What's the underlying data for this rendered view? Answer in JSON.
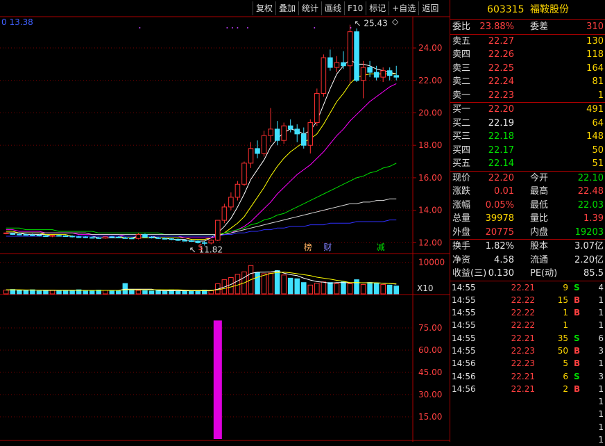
{
  "toolbar": [
    "复权",
    "叠加",
    "统计",
    "画线",
    "F10",
    "标记",
    "+自选",
    "返回"
  ],
  "stock": {
    "code": "603315",
    "name": "福鞍股份"
  },
  "main_chart": {
    "top_label": "0 13.38",
    "price_ticks": [
      "24.00",
      "22.00",
      "20.00",
      "18.00",
      "16.00",
      "14.00",
      "12.00"
    ],
    "high_label": "25.43",
    "low_label": "11.82",
    "events": [
      {
        "text": "$",
        "color": "#ff4040"
      },
      {
        "text": "榜",
        "color": "#ffb060"
      },
      {
        "text": "财",
        "color": "#8080ff"
      },
      {
        "text": "减",
        "color": "#00e000"
      }
    ],
    "marks": [
      "◇",
      "×"
    ]
  },
  "volume_chart": {
    "tick": "10000",
    "unit": "X10"
  },
  "indicator_chart": {
    "ticks": [
      "75.00",
      "60.00",
      "45.00",
      "30.00",
      "15.00"
    ],
    "bar_value": 80
  },
  "chart_data": {
    "type": "candlestick",
    "y_range": [
      11.5,
      25.8
    ],
    "candles": [
      [
        12.6,
        12.62,
        12.52,
        12.6
      ],
      [
        12.55,
        12.6,
        12.48,
        12.52
      ],
      [
        12.52,
        12.58,
        12.45,
        12.5
      ],
      [
        12.5,
        12.56,
        12.44,
        12.48
      ],
      [
        12.48,
        12.55,
        12.4,
        12.46
      ],
      [
        12.46,
        12.52,
        12.38,
        12.42
      ],
      [
        12.42,
        12.5,
        12.35,
        12.4
      ],
      [
        12.4,
        12.48,
        12.34,
        12.44
      ],
      [
        12.44,
        12.5,
        12.38,
        12.42
      ],
      [
        12.42,
        12.46,
        12.36,
        12.4
      ],
      [
        12.4,
        12.45,
        12.32,
        12.36
      ],
      [
        12.36,
        12.42,
        12.3,
        12.35
      ],
      [
        12.35,
        12.4,
        12.28,
        12.32
      ],
      [
        12.32,
        12.38,
        12.26,
        12.3
      ],
      [
        12.3,
        12.36,
        12.24,
        12.28
      ],
      [
        12.28,
        12.4,
        12.24,
        12.36
      ],
      [
        12.36,
        12.42,
        12.3,
        12.34
      ],
      [
        12.34,
        12.4,
        12.28,
        12.3
      ],
      [
        12.3,
        12.36,
        12.25,
        12.28
      ],
      [
        12.28,
        12.34,
        12.22,
        12.26
      ],
      [
        12.26,
        12.6,
        12.2,
        12.5
      ],
      [
        12.5,
        12.56,
        12.3,
        12.34
      ],
      [
        12.34,
        12.4,
        12.26,
        12.3
      ],
      [
        12.3,
        12.36,
        12.22,
        12.26
      ],
      [
        12.26,
        12.32,
        12.2,
        12.24
      ],
      [
        12.24,
        12.3,
        12.15,
        12.2
      ],
      [
        12.2,
        12.26,
        12.1,
        12.14
      ],
      [
        12.14,
        12.2,
        12.08,
        12.12
      ],
      [
        12.12,
        12.18,
        12.05,
        12.1
      ],
      [
        12.1,
        12.15,
        11.95,
        12.0
      ],
      [
        12.0,
        12.1,
        11.82,
        11.98
      ],
      [
        11.98,
        12.2,
        11.9,
        12.15
      ],
      [
        12.15,
        13.38,
        12.1,
        13.38
      ],
      [
        13.38,
        14.4,
        13.2,
        14.2
      ],
      [
        14.2,
        15.1,
        14.0,
        14.8
      ],
      [
        14.8,
        15.8,
        14.6,
        15.6
      ],
      [
        15.6,
        17.0,
        15.5,
        16.9
      ],
      [
        16.9,
        18.2,
        16.6,
        17.8
      ],
      [
        17.8,
        18.3,
        17.2,
        17.5
      ],
      [
        17.5,
        18.9,
        17.3,
        18.6
      ],
      [
        18.6,
        20.3,
        18.2,
        19.0
      ],
      [
        19.0,
        19.5,
        18.0,
        18.3
      ],
      [
        18.3,
        19.4,
        18.1,
        19.2
      ],
      [
        19.2,
        19.6,
        18.8,
        19.0
      ],
      [
        19.0,
        19.3,
        18.2,
        18.7
      ],
      [
        18.7,
        19.1,
        17.8,
        18.0
      ],
      [
        18.0,
        19.6,
        17.5,
        19.4
      ],
      [
        19.4,
        21.5,
        19.2,
        21.2
      ],
      [
        21.2,
        23.6,
        21.0,
        23.4
      ],
      [
        23.4,
        23.9,
        22.6,
        22.8
      ],
      [
        22.8,
        23.5,
        22.5,
        23.1
      ],
      [
        23.1,
        23.8,
        22.7,
        22.9
      ],
      [
        22.9,
        25.43,
        21.8,
        25.0
      ],
      [
        25.0,
        25.2,
        21.9,
        22.0
      ],
      [
        22.0,
        23.2,
        20.9,
        22.8
      ],
      [
        22.8,
        23.2,
        22.2,
        22.5
      ],
      [
        22.5,
        22.9,
        22.0,
        22.2
      ],
      [
        22.2,
        22.8,
        21.9,
        22.6
      ],
      [
        22.6,
        22.8,
        22.0,
        22.3
      ],
      [
        22.3,
        22.9,
        22.0,
        22.2
      ]
    ],
    "ma": [
      {
        "color": "#ffffff",
        "values": [
          12.6,
          12.6,
          12.6,
          12.5,
          12.5,
          12.5,
          12.5,
          12.4,
          12.4,
          12.4,
          12.4,
          12.4,
          12.4,
          12.4,
          12.3,
          12.3,
          12.3,
          12.3,
          12.3,
          12.3,
          12.4,
          12.4,
          12.4,
          12.3,
          12.3,
          12.2,
          12.2,
          12.2,
          12.1,
          12.1,
          12.1,
          12.3,
          12.6,
          13.0,
          13.5,
          14.2,
          15.0,
          15.9,
          16.5,
          17.1,
          17.9,
          18.4,
          18.8,
          19.0,
          18.9,
          18.7,
          18.9,
          19.5,
          20.5,
          21.5,
          22.4,
          22.9,
          23.3,
          23.0,
          23.0,
          22.9,
          22.7,
          22.6,
          22.5,
          22.4
        ]
      },
      {
        "color": "#ffff00",
        "values": [
          12.7,
          12.7,
          12.6,
          12.6,
          12.6,
          12.6,
          12.5,
          12.5,
          12.5,
          12.5,
          12.4,
          12.4,
          12.4,
          12.4,
          12.4,
          12.4,
          12.4,
          12.4,
          12.3,
          12.3,
          12.3,
          12.3,
          12.3,
          12.3,
          12.3,
          12.3,
          12.3,
          12.3,
          12.2,
          12.2,
          12.2,
          12.3,
          12.4,
          12.6,
          12.9,
          13.2,
          13.6,
          14.2,
          14.8,
          15.4,
          16.1,
          16.7,
          17.2,
          17.6,
          17.9,
          18.2,
          18.4,
          18.7,
          19.3,
          20.0,
          20.7,
          21.2,
          21.8,
          22.2,
          22.3,
          22.4,
          22.4,
          22.4,
          22.4,
          22.4
        ]
      },
      {
        "color": "#ff00ff",
        "values": [
          12.8,
          12.8,
          12.7,
          12.7,
          12.7,
          12.7,
          12.6,
          12.6,
          12.6,
          12.6,
          12.6,
          12.5,
          12.5,
          12.5,
          12.5,
          12.5,
          12.5,
          12.5,
          12.4,
          12.4,
          12.4,
          12.4,
          12.4,
          12.4,
          12.4,
          12.4,
          12.4,
          12.3,
          12.3,
          12.3,
          12.3,
          12.3,
          12.4,
          12.5,
          12.6,
          12.8,
          13.0,
          13.3,
          13.7,
          14.1,
          14.5,
          15.0,
          15.4,
          15.8,
          16.2,
          16.5,
          16.8,
          17.2,
          17.6,
          18.1,
          18.6,
          19.0,
          19.5,
          19.9,
          20.3,
          20.7,
          21.0,
          21.3,
          21.6,
          21.8
        ]
      },
      {
        "color": "#00e000",
        "values": [
          12.9,
          12.9,
          12.9,
          12.8,
          12.8,
          12.8,
          12.8,
          12.8,
          12.7,
          12.7,
          12.7,
          12.7,
          12.7,
          12.7,
          12.6,
          12.6,
          12.6,
          12.6,
          12.6,
          12.6,
          12.6,
          12.6,
          12.6,
          12.6,
          12.5,
          12.5,
          12.5,
          12.5,
          12.5,
          12.5,
          12.5,
          12.5,
          12.5,
          12.6,
          12.7,
          12.8,
          12.9,
          13.1,
          13.2,
          13.4,
          13.5,
          13.7,
          13.8,
          14.0,
          14.2,
          14.4,
          14.6,
          14.8,
          15.0,
          15.2,
          15.4,
          15.6,
          15.8,
          16.0,
          16.1,
          16.3,
          16.4,
          16.6,
          16.7,
          16.9
        ]
      },
      {
        "color": "#d8d8d8",
        "values": [
          12.6,
          12.6,
          12.6,
          12.6,
          12.6,
          12.6,
          12.6,
          12.6,
          12.6,
          12.6,
          12.6,
          12.6,
          12.6,
          12.5,
          12.5,
          12.5,
          12.5,
          12.5,
          12.5,
          12.5,
          12.5,
          12.5,
          12.5,
          12.5,
          12.5,
          12.5,
          12.5,
          12.5,
          12.5,
          12.5,
          12.5,
          12.5,
          12.5,
          12.5,
          12.6,
          12.7,
          12.8,
          12.9,
          13.0,
          13.1,
          13.2,
          13.3,
          13.4,
          13.5,
          13.6,
          13.7,
          13.8,
          13.9,
          14.0,
          14.1,
          14.2,
          14.3,
          14.4,
          14.4,
          14.5,
          14.5,
          14.6,
          14.6,
          14.7,
          14.7
        ]
      },
      {
        "color": "#3030ff",
        "values": [
          12.4,
          12.4,
          12.4,
          12.4,
          12.4,
          12.4,
          12.4,
          12.4,
          12.4,
          12.4,
          12.4,
          12.4,
          12.4,
          12.4,
          12.4,
          12.4,
          12.4,
          12.4,
          12.4,
          12.4,
          12.4,
          12.4,
          12.4,
          12.4,
          12.4,
          12.4,
          12.4,
          12.4,
          12.4,
          12.4,
          12.4,
          12.4,
          12.4,
          12.5,
          12.5,
          12.6,
          12.6,
          12.7,
          12.7,
          12.8,
          12.8,
          12.9,
          12.9,
          13.0,
          13.0,
          13.0,
          13.1,
          13.1,
          13.1,
          13.2,
          13.2,
          13.2,
          13.2,
          13.3,
          13.3,
          13.3,
          13.3,
          13.3,
          13.4,
          13.4
        ]
      }
    ],
    "volumes": [
      1200,
      1400,
      1000,
      1100,
      1300,
      900,
      1000,
      1200,
      1100,
      1000,
      900,
      1300,
      1100,
      1000,
      1200,
      1100,
      1000,
      900,
      3300,
      1200,
      1100,
      1000,
      900,
      1100,
      1000,
      1200,
      900,
      1000,
      1100,
      900,
      1200,
      1000,
      3200,
      4500,
      5200,
      6200,
      7000,
      9000,
      6800,
      6400,
      6600,
      7400,
      6000,
      5000,
      4800,
      3600,
      2800,
      3400,
      3800,
      3600,
      3200,
      3800,
      3200,
      4500,
      3000,
      3600,
      3400,
      3000,
      2800,
      2500
    ],
    "vol_ma": [
      {
        "color": "#ffffff",
        "values": [
          1250,
          1250,
          1200,
          1200,
          1200,
          1150,
          1100,
          1100,
          1100,
          1100,
          1100,
          1100,
          1100,
          1100,
          1100,
          1100,
          1100,
          1100,
          1500,
          1500,
          1500,
          1500,
          1500,
          1100,
          1000,
          1000,
          1000,
          1000,
          1000,
          1000,
          1000,
          1000,
          1500,
          2200,
          3000,
          4100,
          5200,
          6500,
          6900,
          6900,
          7000,
          7300,
          6600,
          6100,
          5800,
          5000,
          4400,
          3900,
          3700,
          3400,
          3600,
          3600,
          3500,
          3600,
          3500,
          3600,
          3500,
          3400,
          3300,
          3100
        ]
      },
      {
        "color": "#ffff00",
        "values": [
          1300,
          1300,
          1300,
          1250,
          1250,
          1200,
          1200,
          1200,
          1150,
          1150,
          1150,
          1150,
          1100,
          1100,
          1100,
          1100,
          1100,
          1100,
          1300,
          1300,
          1300,
          1300,
          1300,
          1300,
          1300,
          1300,
          1300,
          1200,
          1100,
          1100,
          1100,
          1100,
          1300,
          1700,
          2200,
          2800,
          3500,
          4500,
          5300,
          5900,
          6500,
          6800,
          6900,
          6700,
          6400,
          6100,
          5800,
          5300,
          5000,
          4700,
          4300,
          4000,
          3600,
          3600,
          3500,
          3500,
          3500,
          3400,
          3300,
          3200
        ]
      }
    ]
  },
  "quote": {
    "weibi": {
      "label": "委比",
      "value": "23.88%",
      "label2": "委差",
      "value2": "310"
    },
    "asks": [
      {
        "label": "卖五",
        "price": "22.27",
        "vol": "130"
      },
      {
        "label": "卖四",
        "price": "22.26",
        "vol": "118"
      },
      {
        "label": "卖三",
        "price": "22.25",
        "vol": "164"
      },
      {
        "label": "卖二",
        "price": "22.24",
        "vol": "81"
      },
      {
        "label": "卖一",
        "price": "22.23",
        "vol": "1"
      }
    ],
    "bids": [
      {
        "label": "买一",
        "price": "22.20",
        "vol": "491",
        "color": "red"
      },
      {
        "label": "买二",
        "price": "22.19",
        "vol": "64",
        "color": "white"
      },
      {
        "label": "买三",
        "price": "22.18",
        "vol": "148",
        "color": "green"
      },
      {
        "label": "买四",
        "price": "22.17",
        "vol": "50",
        "color": "green"
      },
      {
        "label": "买五",
        "price": "22.14",
        "vol": "51",
        "color": "green"
      }
    ],
    "stats1": [
      {
        "l1": "现价",
        "v1": "22.20",
        "c1": "red",
        "l2": "今开",
        "v2": "22.10",
        "c2": "green"
      },
      {
        "l1": "涨跌",
        "v1": "0.01",
        "c1": "red",
        "l2": "最高",
        "v2": "22.48",
        "c2": "red"
      },
      {
        "l1": "涨幅",
        "v1": "0.05%",
        "c1": "red",
        "l2": "最低",
        "v2": "22.03",
        "c2": "green"
      },
      {
        "l1": "总量",
        "v1": "39978",
        "c1": "yellow",
        "l2": "量比",
        "v2": "1.39",
        "c2": "red"
      },
      {
        "l1": "外盘",
        "v1": "20775",
        "c1": "red",
        "l2": "内盘",
        "v2": "19203",
        "c2": "green"
      }
    ],
    "stats2": [
      {
        "l1": "换手",
        "v1": "1.82%",
        "l2": "股本",
        "v2": "3.07亿"
      },
      {
        "l1": "净资",
        "v1": "4.58",
        "l2": "流通",
        "v2": "2.20亿"
      },
      {
        "l1": "收益(三)",
        "v1": "0.130",
        "l2": "PE(动)",
        "v2": "85.5"
      }
    ]
  },
  "ticks": [
    {
      "time": "14:55",
      "price": "22.21",
      "vol": "9",
      "bs": "S",
      "n": "4"
    },
    {
      "time": "14:55",
      "price": "22.22",
      "vol": "15",
      "bs": "B",
      "n": "1"
    },
    {
      "time": "14:55",
      "price": "22.22",
      "vol": "1",
      "bs": "B",
      "n": "1"
    },
    {
      "time": "14:55",
      "price": "22.22",
      "vol": "1",
      "bs": "",
      "n": "1"
    },
    {
      "time": "14:55",
      "price": "22.21",
      "vol": "35",
      "bs": "S",
      "n": "6"
    },
    {
      "time": "14:55",
      "price": "22.23",
      "vol": "50",
      "bs": "B",
      "n": "3"
    },
    {
      "time": "14:56",
      "price": "22.23",
      "vol": "5",
      "bs": "B",
      "n": "1"
    },
    {
      "time": "14:56",
      "price": "22.21",
      "vol": "6",
      "bs": "S",
      "n": "3"
    },
    {
      "time": "14:56",
      "price": "22.21",
      "vol": "2",
      "bs": "B",
      "n": "1"
    }
  ],
  "tick_tail": [
    "1",
    "1",
    "1",
    "1"
  ]
}
